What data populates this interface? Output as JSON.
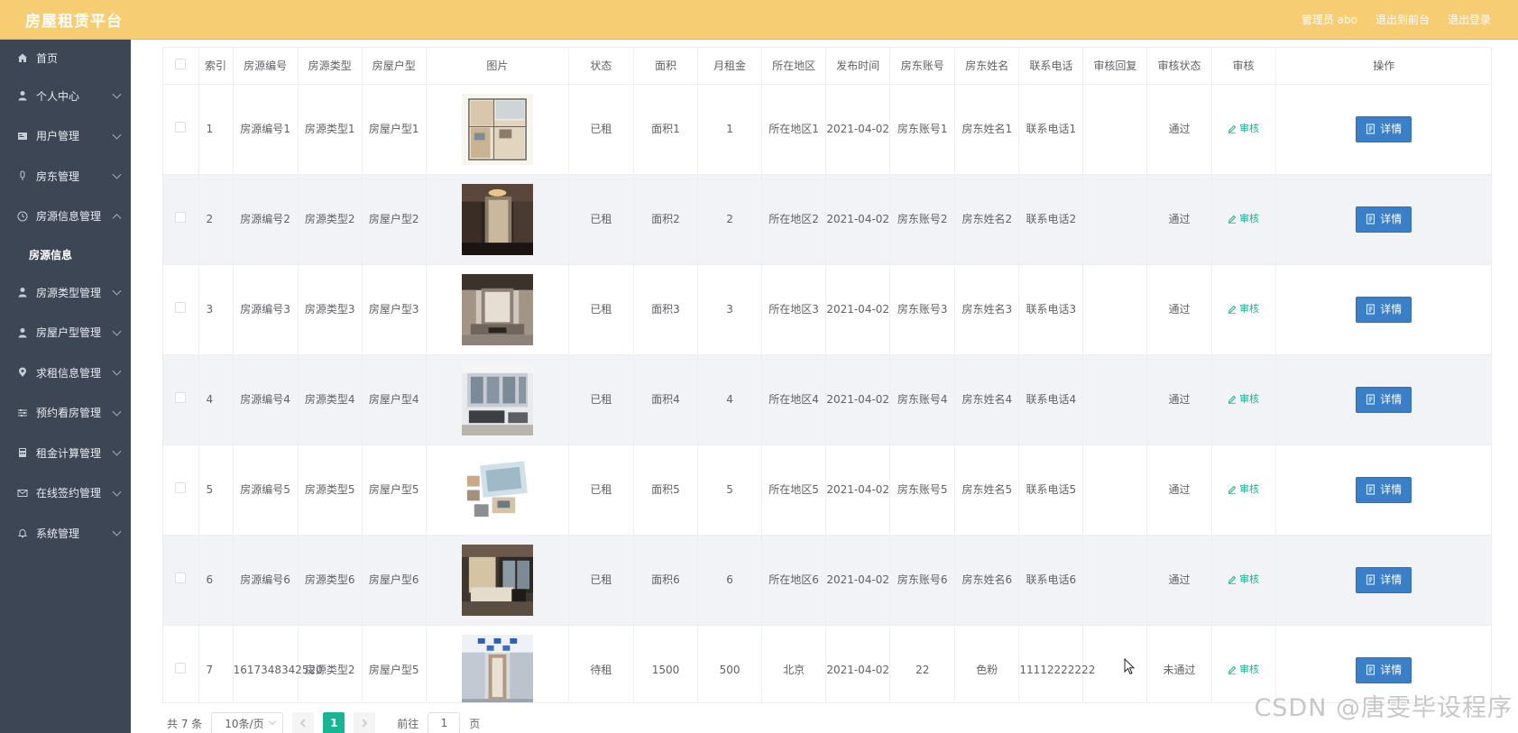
{
  "header": {
    "brand": "房屋租赁平台",
    "admin_label": "管理员 abo",
    "back_front": "退出到前台",
    "logout": "退出登录"
  },
  "sidebar": {
    "items": [
      {
        "label": "首页",
        "icon": "home-icon"
      },
      {
        "label": "个人中心",
        "icon": "user-icon"
      },
      {
        "label": "用户管理",
        "icon": "card-icon"
      },
      {
        "label": "房东管理",
        "icon": "mic-icon"
      },
      {
        "label": "房源信息管理",
        "icon": "clock-icon",
        "expanded": true,
        "children": [
          "房源信息"
        ]
      },
      {
        "label": "房源类型管理",
        "icon": "person-icon"
      },
      {
        "label": "房屋户型管理",
        "icon": "person-icon"
      },
      {
        "label": "求租信息管理",
        "icon": "location-icon"
      },
      {
        "label": "预约看房管理",
        "icon": "sliders-icon"
      },
      {
        "label": "租金计算管理",
        "icon": "calc-icon"
      },
      {
        "label": "在线签约管理",
        "icon": "mail-icon"
      },
      {
        "label": "系统管理",
        "icon": "bell-icon"
      }
    ]
  },
  "table": {
    "headers": [
      "索引",
      "房源编号",
      "房源类型",
      "房屋户型",
      "图片",
      "状态",
      "面积",
      "月租金",
      "所在地区",
      "发布时间",
      "房东账号",
      "房东姓名",
      "联系电话",
      "审核回复",
      "审核状态",
      "审核",
      "操作"
    ],
    "review_label": "审核",
    "detail_label": "详情",
    "rows": [
      {
        "index": "1",
        "code": "房源编号1",
        "type": "房源类型1",
        "layout": "房屋户型1",
        "image": "floorplan",
        "status": "已租",
        "area": "面积1",
        "rent": "1",
        "region": "所在地区1",
        "date": "2021-04-02",
        "landlord_account": "房东账号1",
        "landlord_name": "房东姓名1",
        "phone": "联系电话1",
        "reply": "",
        "audit_status": "通过"
      },
      {
        "index": "2",
        "code": "房源编号2",
        "type": "房源类型2",
        "layout": "房屋户型2",
        "image": "lobby",
        "status": "已租",
        "area": "面积2",
        "rent": "2",
        "region": "所在地区2",
        "date": "2021-04-02",
        "landlord_account": "房东账号2",
        "landlord_name": "房东姓名2",
        "phone": "联系电话2",
        "reply": "",
        "audit_status": "通过"
      },
      {
        "index": "3",
        "code": "房源编号3",
        "type": "房源类型3",
        "layout": "房屋户型3",
        "image": "livingroom",
        "status": "已租",
        "area": "面积3",
        "rent": "3",
        "region": "所在地区3",
        "date": "2021-04-02",
        "landlord_account": "房东账号3",
        "landlord_name": "房东姓名3",
        "phone": "联系电话3",
        "reply": "",
        "audit_status": "通过"
      },
      {
        "index": "4",
        "code": "房源编号4",
        "type": "房源类型4",
        "layout": "房屋户型4",
        "image": "bright",
        "status": "已租",
        "area": "面积4",
        "rent": "4",
        "region": "所在地区4",
        "date": "2021-04-02",
        "landlord_account": "房东账号4",
        "landlord_name": "房东姓名4",
        "phone": "联系电话4",
        "reply": "",
        "audit_status": "通过"
      },
      {
        "index": "5",
        "code": "房源编号5",
        "type": "房源类型5",
        "layout": "房屋户型5",
        "image": "collage",
        "status": "已租",
        "area": "面积5",
        "rent": "5",
        "region": "所在地区5",
        "date": "2021-04-02",
        "landlord_account": "房东账号5",
        "landlord_name": "房东姓名5",
        "phone": "联系电话5",
        "reply": "",
        "audit_status": "通过"
      },
      {
        "index": "6",
        "code": "房源编号6",
        "type": "房源类型6",
        "layout": "房屋户型6",
        "image": "bedroom",
        "status": "已租",
        "area": "面积6",
        "rent": "6",
        "region": "所在地区6",
        "date": "2021-04-02",
        "landlord_account": "房东账号6",
        "landlord_name": "房东姓名6",
        "phone": "联系电话6",
        "reply": "",
        "audit_status": "通过"
      },
      {
        "index": "7",
        "code": "1617348342520",
        "type": "房源类型2",
        "layout": "房屋户型5",
        "image": "hallway",
        "status": "待租",
        "area": "1500",
        "rent": "500",
        "region": "北京",
        "date": "2021-04-02",
        "landlord_account": "22",
        "landlord_name": "色粉",
        "phone": "11112222222",
        "reply": "",
        "audit_status": "未通过"
      }
    ]
  },
  "pagination": {
    "total": "共 7 条",
    "page_size": "10条/页",
    "current_page": "1",
    "goto_label": "前往",
    "goto_value": "1",
    "page_suffix": "页"
  },
  "watermark": "CSDN @唐雯毕设程序",
  "colors": {
    "header": "#f6cd72",
    "sidebar": "#3d4654",
    "accent": "#1ab394",
    "button": "#3a7fc8"
  }
}
